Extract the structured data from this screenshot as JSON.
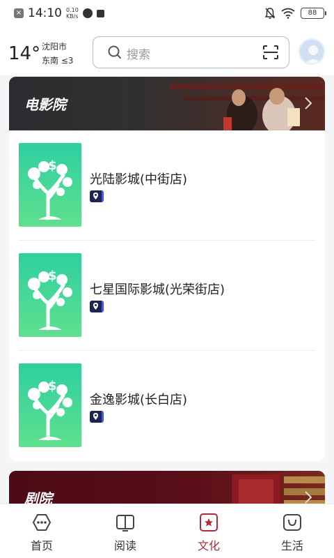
{
  "status_bar": {
    "time": "14:10",
    "net_speed_value": "0.10",
    "net_speed_unit": "KB/s",
    "battery": "88"
  },
  "header": {
    "temperature": "14°",
    "city": "沈阳市",
    "wind": "东南 ≤3",
    "search_placeholder": "搜索"
  },
  "cinema_section": {
    "title": "电影院",
    "items": [
      {
        "name": "光陆影城(中街店)"
      },
      {
        "name": "七星国际影城(光荣街店)"
      },
      {
        "name": "金逸影城(长白店)"
      }
    ]
  },
  "theater_section": {
    "title": "剧院"
  },
  "bottom_nav": {
    "items": [
      {
        "label": "首页",
        "icon": "home-bubble-icon"
      },
      {
        "label": "阅读",
        "icon": "book-icon"
      },
      {
        "label": "文化",
        "icon": "star-badge-icon",
        "active": true
      },
      {
        "label": "生活",
        "icon": "smile-bag-icon"
      }
    ],
    "active_color": "#b02b3a"
  }
}
